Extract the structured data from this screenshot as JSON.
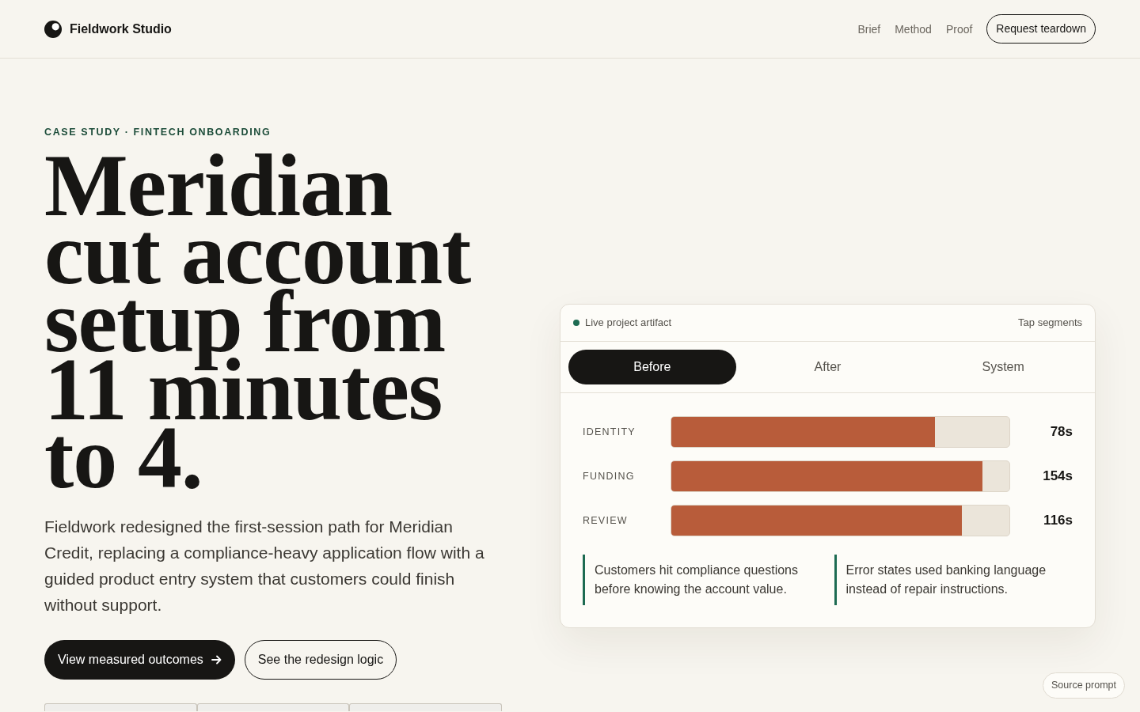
{
  "header": {
    "brand": "Fieldwork Studio",
    "nav": [
      {
        "label": "Brief"
      },
      {
        "label": "Method"
      },
      {
        "label": "Proof"
      }
    ],
    "cta": "Request teardown"
  },
  "hero": {
    "eyebrow": "CASE STUDY · FINTECH ONBOARDING",
    "title": "Meridian cut account setup from 11 minutes to 4.",
    "description": "Fieldwork redesigned the first-session path for Meridian Credit, replacing a compliance-heavy application flow with a guided product entry system that customers could finish without support.",
    "buttons": [
      {
        "label": "View measured outcomes",
        "kind": "primary"
      },
      {
        "label": "See the redesign logic",
        "kind": "secondary"
      }
    ]
  },
  "artifact": {
    "status": "Live project artifact",
    "hint": "Tap segments",
    "tabs": [
      {
        "label": "Before",
        "selected": true
      },
      {
        "label": "After",
        "selected": false
      },
      {
        "label": "System",
        "selected": false
      }
    ],
    "segments": [
      {
        "label": "IDENTITY",
        "level": 0.78,
        "value": "78s"
      },
      {
        "label": "FUNDING",
        "level": 0.92,
        "value": "154s"
      },
      {
        "label": "REVIEW",
        "level": 0.86,
        "value": "116s"
      }
    ],
    "notes": [
      "Customers hit compliance questions before knowing the account value.",
      "Error states used banking language instead of repair instructions."
    ]
  },
  "floating_button": "Source prompt"
}
